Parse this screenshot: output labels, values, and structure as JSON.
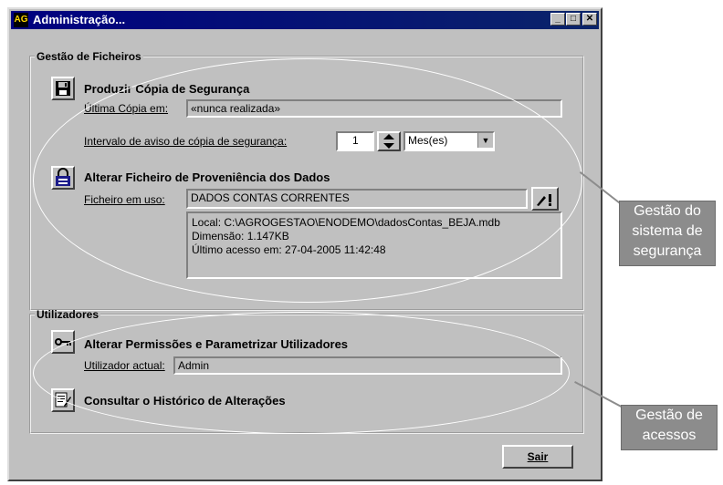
{
  "window": {
    "title": "Administração...",
    "min_label": "_",
    "max_label": "□",
    "close_label": "✕",
    "app_icon_text": "AG"
  },
  "gestao": {
    "legend": "Gestão de Ficheiros",
    "backup_title": "Produzir Cópia de Segurança",
    "last_copy_label": "Última Cópia em:",
    "last_copy_value": "«nunca realizada»",
    "interval_label": "Intervalo de aviso de cópia de segurança:",
    "interval_value": "1",
    "interval_unit": "Mes(es)",
    "alter_title": "Alterar Ficheiro de Proveniência dos Dados",
    "file_label": "Ficheiro em uso:",
    "file_value": "DADOS CONTAS CORRENTES",
    "info_local": "Local: C:\\AGROGESTAO\\ENODEMO\\dadosContas_BEJA.mdb",
    "info_size": "Dimensão: 1.147KB",
    "info_access": "Último acesso em: 27-04-2005 11:42:48"
  },
  "users": {
    "legend": "Utilizadores",
    "perm_title": "Alterar Permissões e Parametrizar Utilizadores",
    "user_label": "Utilizador actual:",
    "user_value": "Admin",
    "history_title": "Consultar o Histórico de Alterações"
  },
  "exit_label": "Sair",
  "callouts": {
    "security": [
      "Gestão do",
      "sistema de",
      "segurança"
    ],
    "access": [
      "Gestão de",
      "acessos"
    ]
  }
}
